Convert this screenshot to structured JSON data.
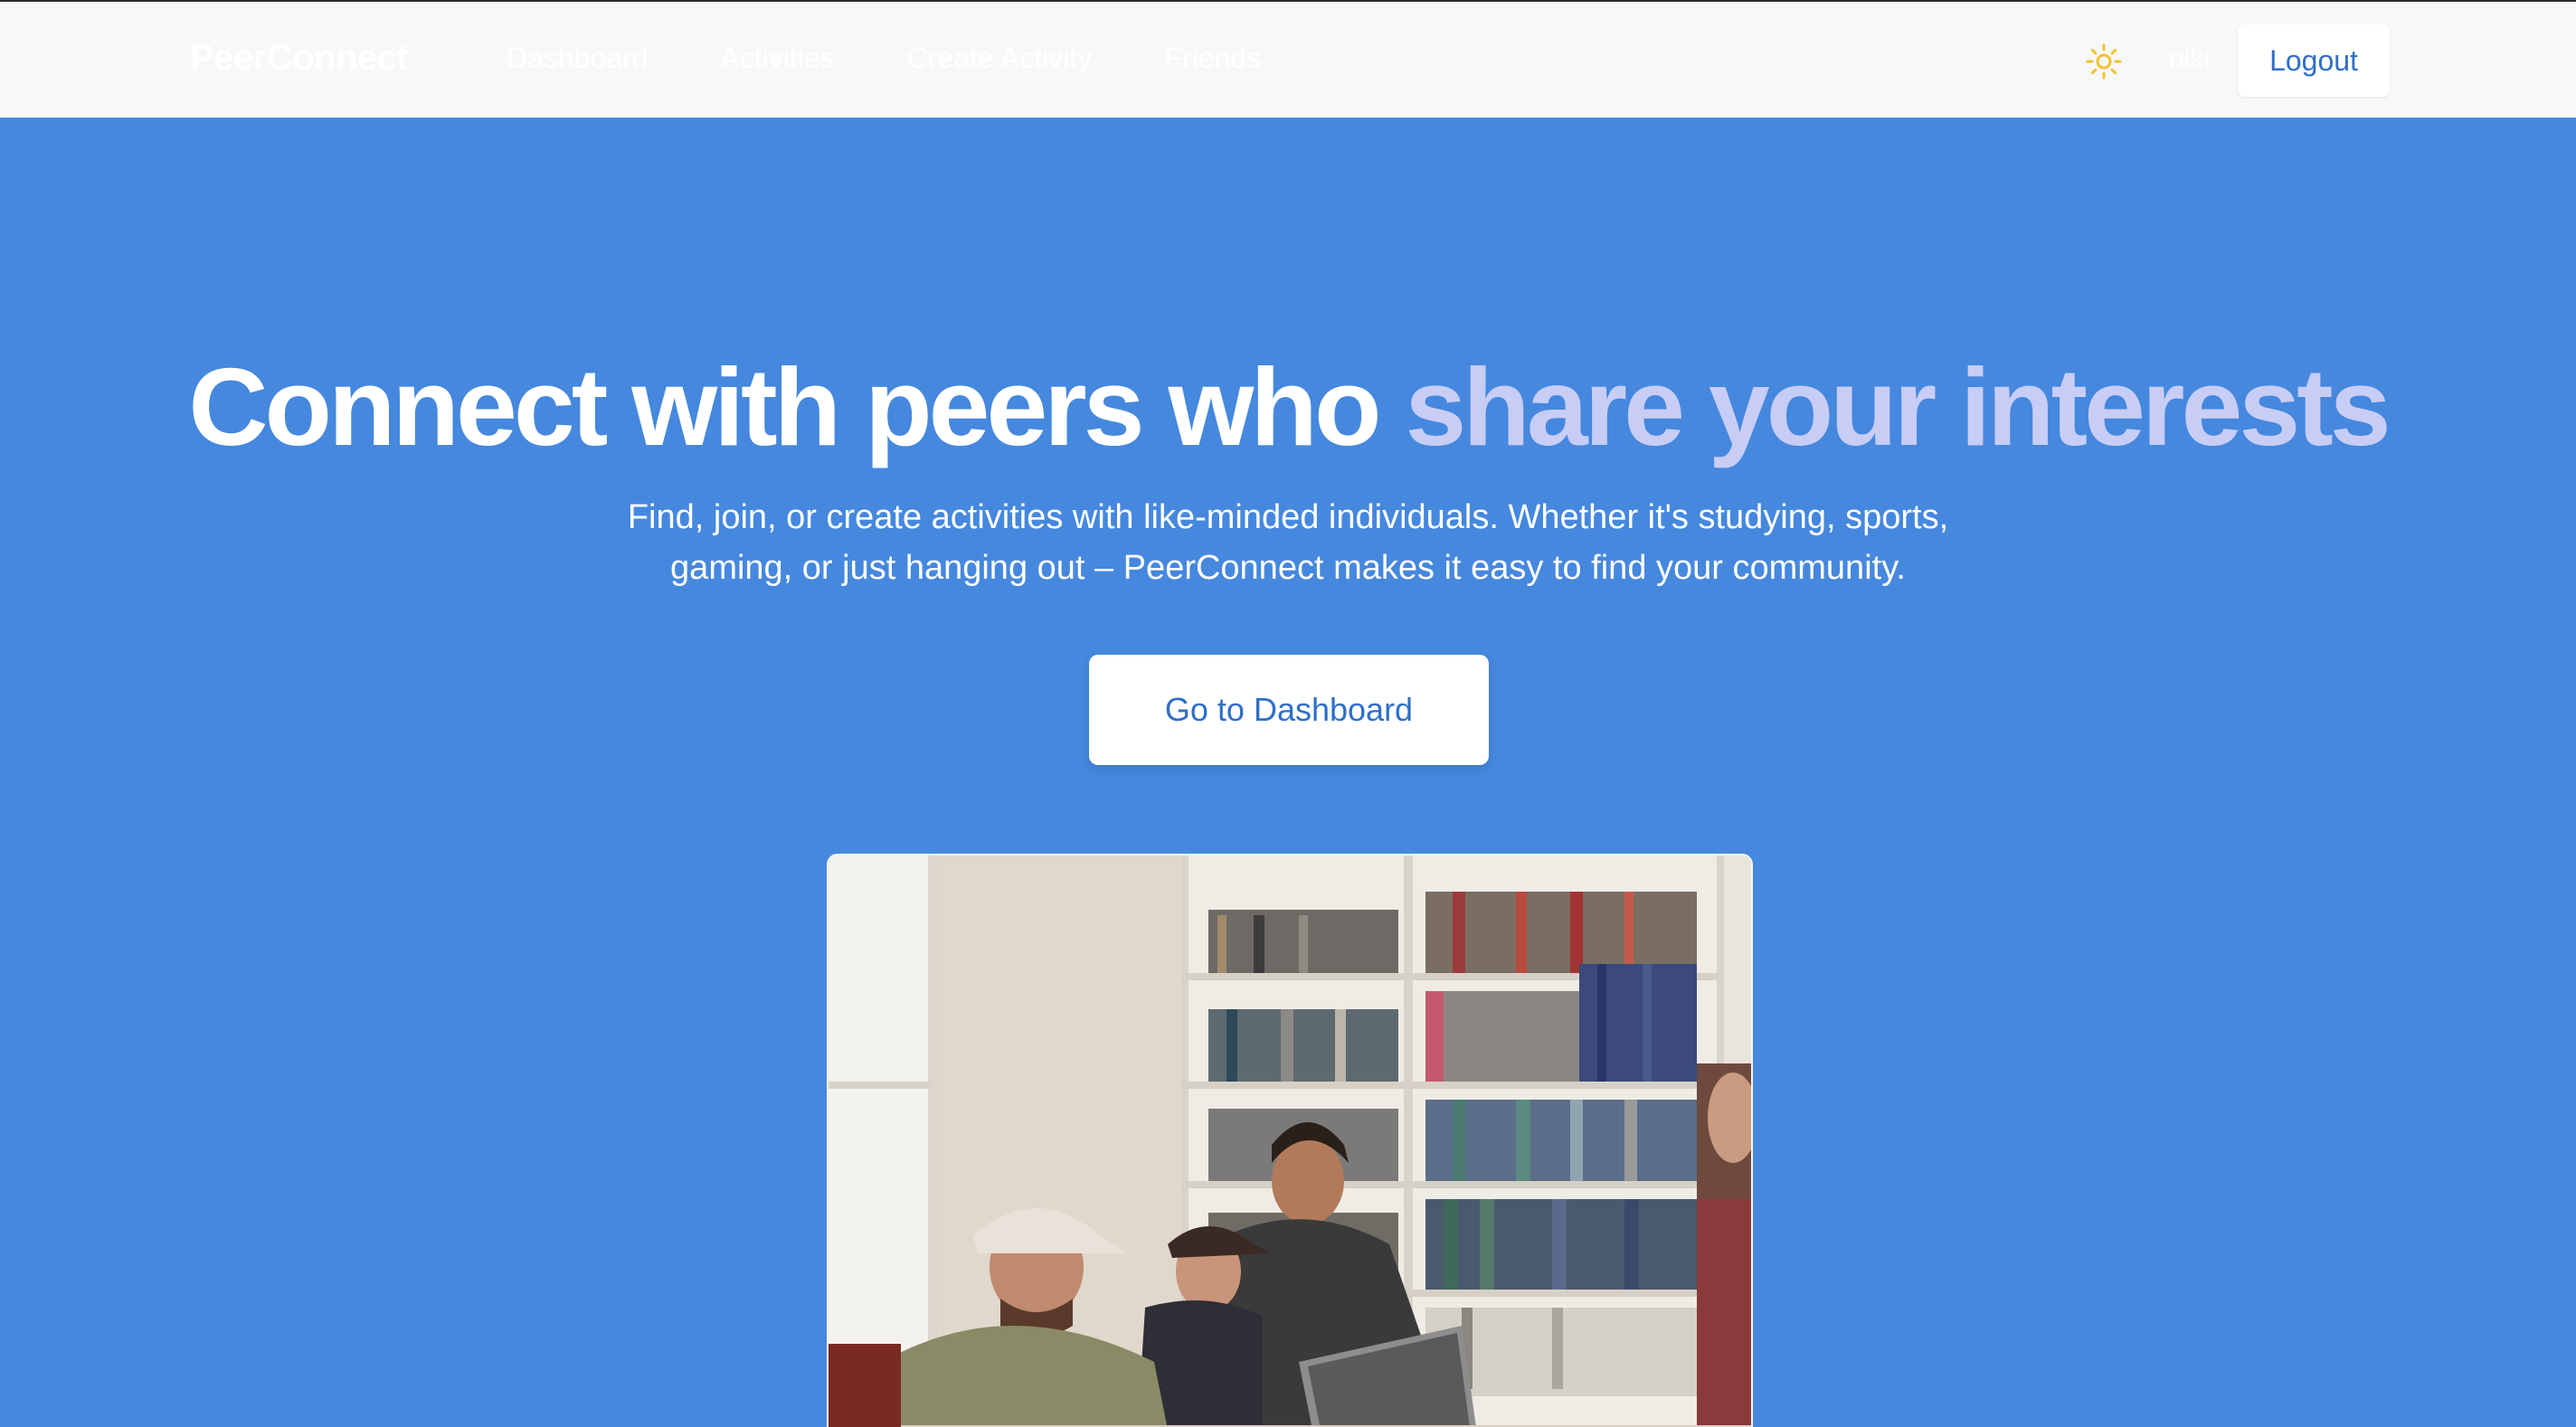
{
  "navbar": {
    "brand": "PeerConnect",
    "links": [
      {
        "label": "Dashboard"
      },
      {
        "label": "Activities"
      },
      {
        "label": "Create Activity"
      },
      {
        "label": "Friends"
      }
    ],
    "theme_icon": "sun-icon",
    "username": "niki",
    "logout_label": "Logout"
  },
  "hero": {
    "headline_main": "Connect with peers who",
    "headline_accent": "share your interests",
    "subtext": "Find, join, or create activities with like-minded individuals. Whether it's studying, sports, gaming, or just hanging out – PeerConnect makes it easy to find your community.",
    "cta_label": "Go to Dashboard",
    "image_icon": "students-library-photo"
  },
  "colors": {
    "hero_bg": "#4588de",
    "navbar_bg": "#f7f8fa",
    "accent_text": "#c8cdf6",
    "button_text": "#2f6fc9",
    "sun": "#f2c230"
  }
}
